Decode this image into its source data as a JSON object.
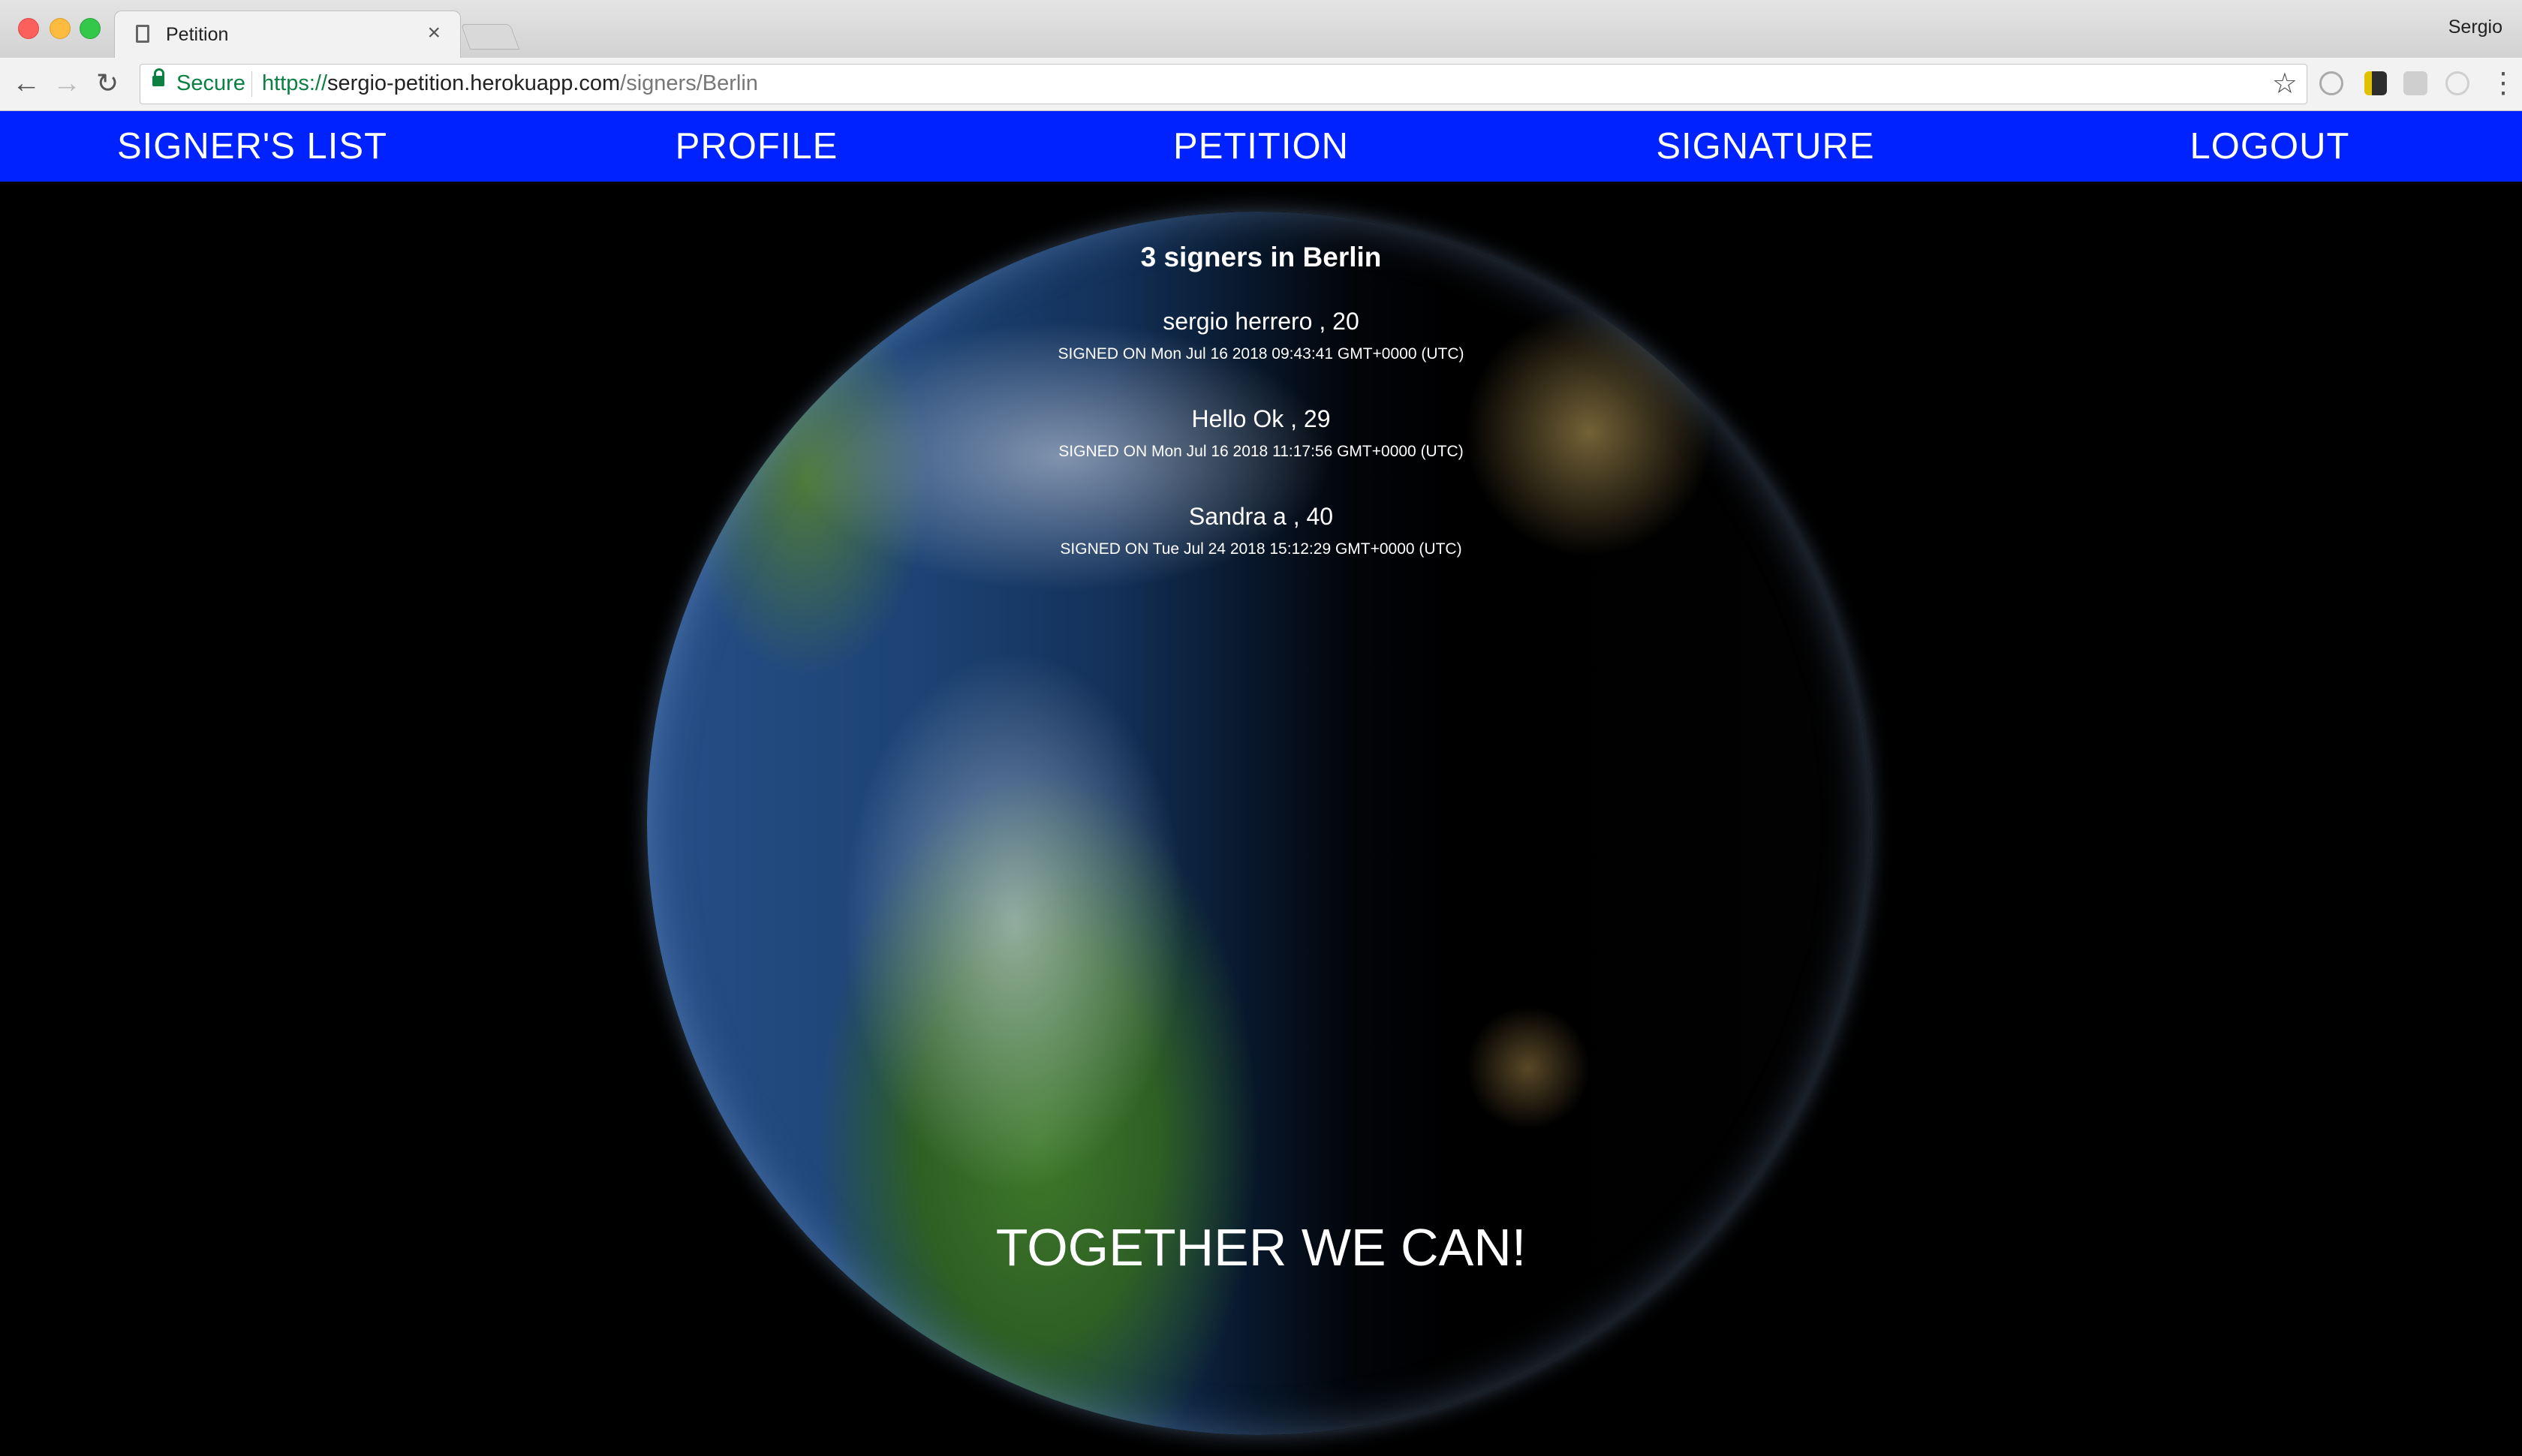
{
  "browser": {
    "tab_title": "Petition",
    "tab_close": "×",
    "profile_name": "Sergio",
    "secure_label": "Secure",
    "url_scheme": "https://",
    "url_host": "sergio-petition.herokuapp.com",
    "url_path": "/signers/Berlin",
    "back": "←",
    "forward": "→",
    "reload": "↻",
    "star": "☆",
    "menu": "⋮"
  },
  "nav": {
    "items": [
      {
        "label": "SIGNER'S LIST"
      },
      {
        "label": "PROFILE"
      },
      {
        "label": "PETITION"
      },
      {
        "label": "SIGNATURE"
      },
      {
        "label": "LOGOUT"
      }
    ],
    "background": "#0022ff"
  },
  "page": {
    "heading": "3 signers in Berlin",
    "signers": [
      {
        "name": "sergio herrero , 20",
        "signed": "SIGNED ON Mon Jul 16 2018 09:43:41 GMT+0000 (UTC)"
      },
      {
        "name": "Hello Ok , 29",
        "signed": "SIGNED ON Mon Jul 16 2018 11:17:56 GMT+0000 (UTC)"
      },
      {
        "name": "Sandra a , 40",
        "signed": "SIGNED ON Tue Jul 24 2018 15:12:29 GMT+0000 (UTC)"
      }
    ],
    "slogan": "TOGETHER WE CAN!"
  }
}
